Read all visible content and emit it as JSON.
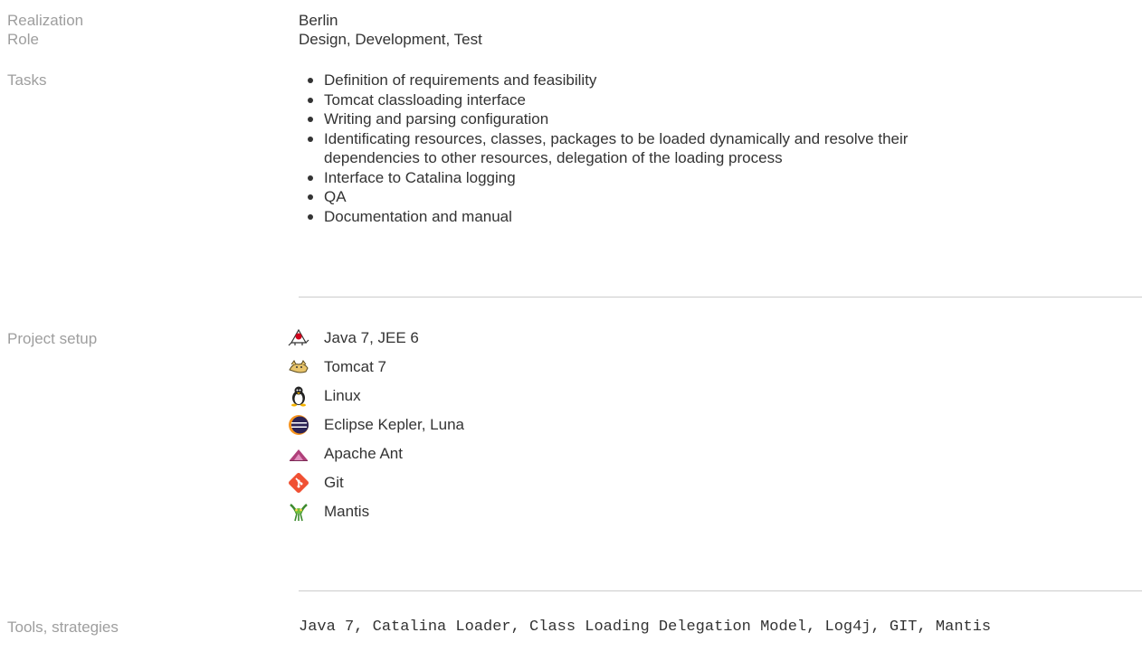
{
  "rows": {
    "realization": {
      "label": "Realization",
      "value": "Berlin"
    },
    "role": {
      "label": "Role",
      "value": "Design, Development, Test"
    },
    "tasks": {
      "label": "Tasks",
      "items": [
        "Definition of requirements and feasibility",
        "Tomcat classloading interface",
        "Writing and parsing configuration",
        "Identificating resources, classes, packages to be loaded dynamically and resolve their dependencies to other resources, delegation of the loading process",
        "Interface to Catalina logging",
        "QA",
        "Documentation and manual"
      ]
    },
    "project_setup": {
      "label": "Project setup",
      "items": [
        {
          "icon": "java-icon",
          "label": "Java 7, JEE 6"
        },
        {
          "icon": "tomcat-icon",
          "label": "Tomcat 7"
        },
        {
          "icon": "linux-icon",
          "label": "Linux"
        },
        {
          "icon": "eclipse-icon",
          "label": "Eclipse Kepler, Luna"
        },
        {
          "icon": "apache-ant-icon",
          "label": "Apache Ant"
        },
        {
          "icon": "git-icon",
          "label": "Git"
        },
        {
          "icon": "mantis-icon",
          "label": "Mantis"
        }
      ]
    },
    "tools": {
      "label": "Tools, strategies",
      "value": "Java 7, Catalina Loader, Class Loading Delegation Model, Log4j, GIT, Mantis"
    }
  }
}
